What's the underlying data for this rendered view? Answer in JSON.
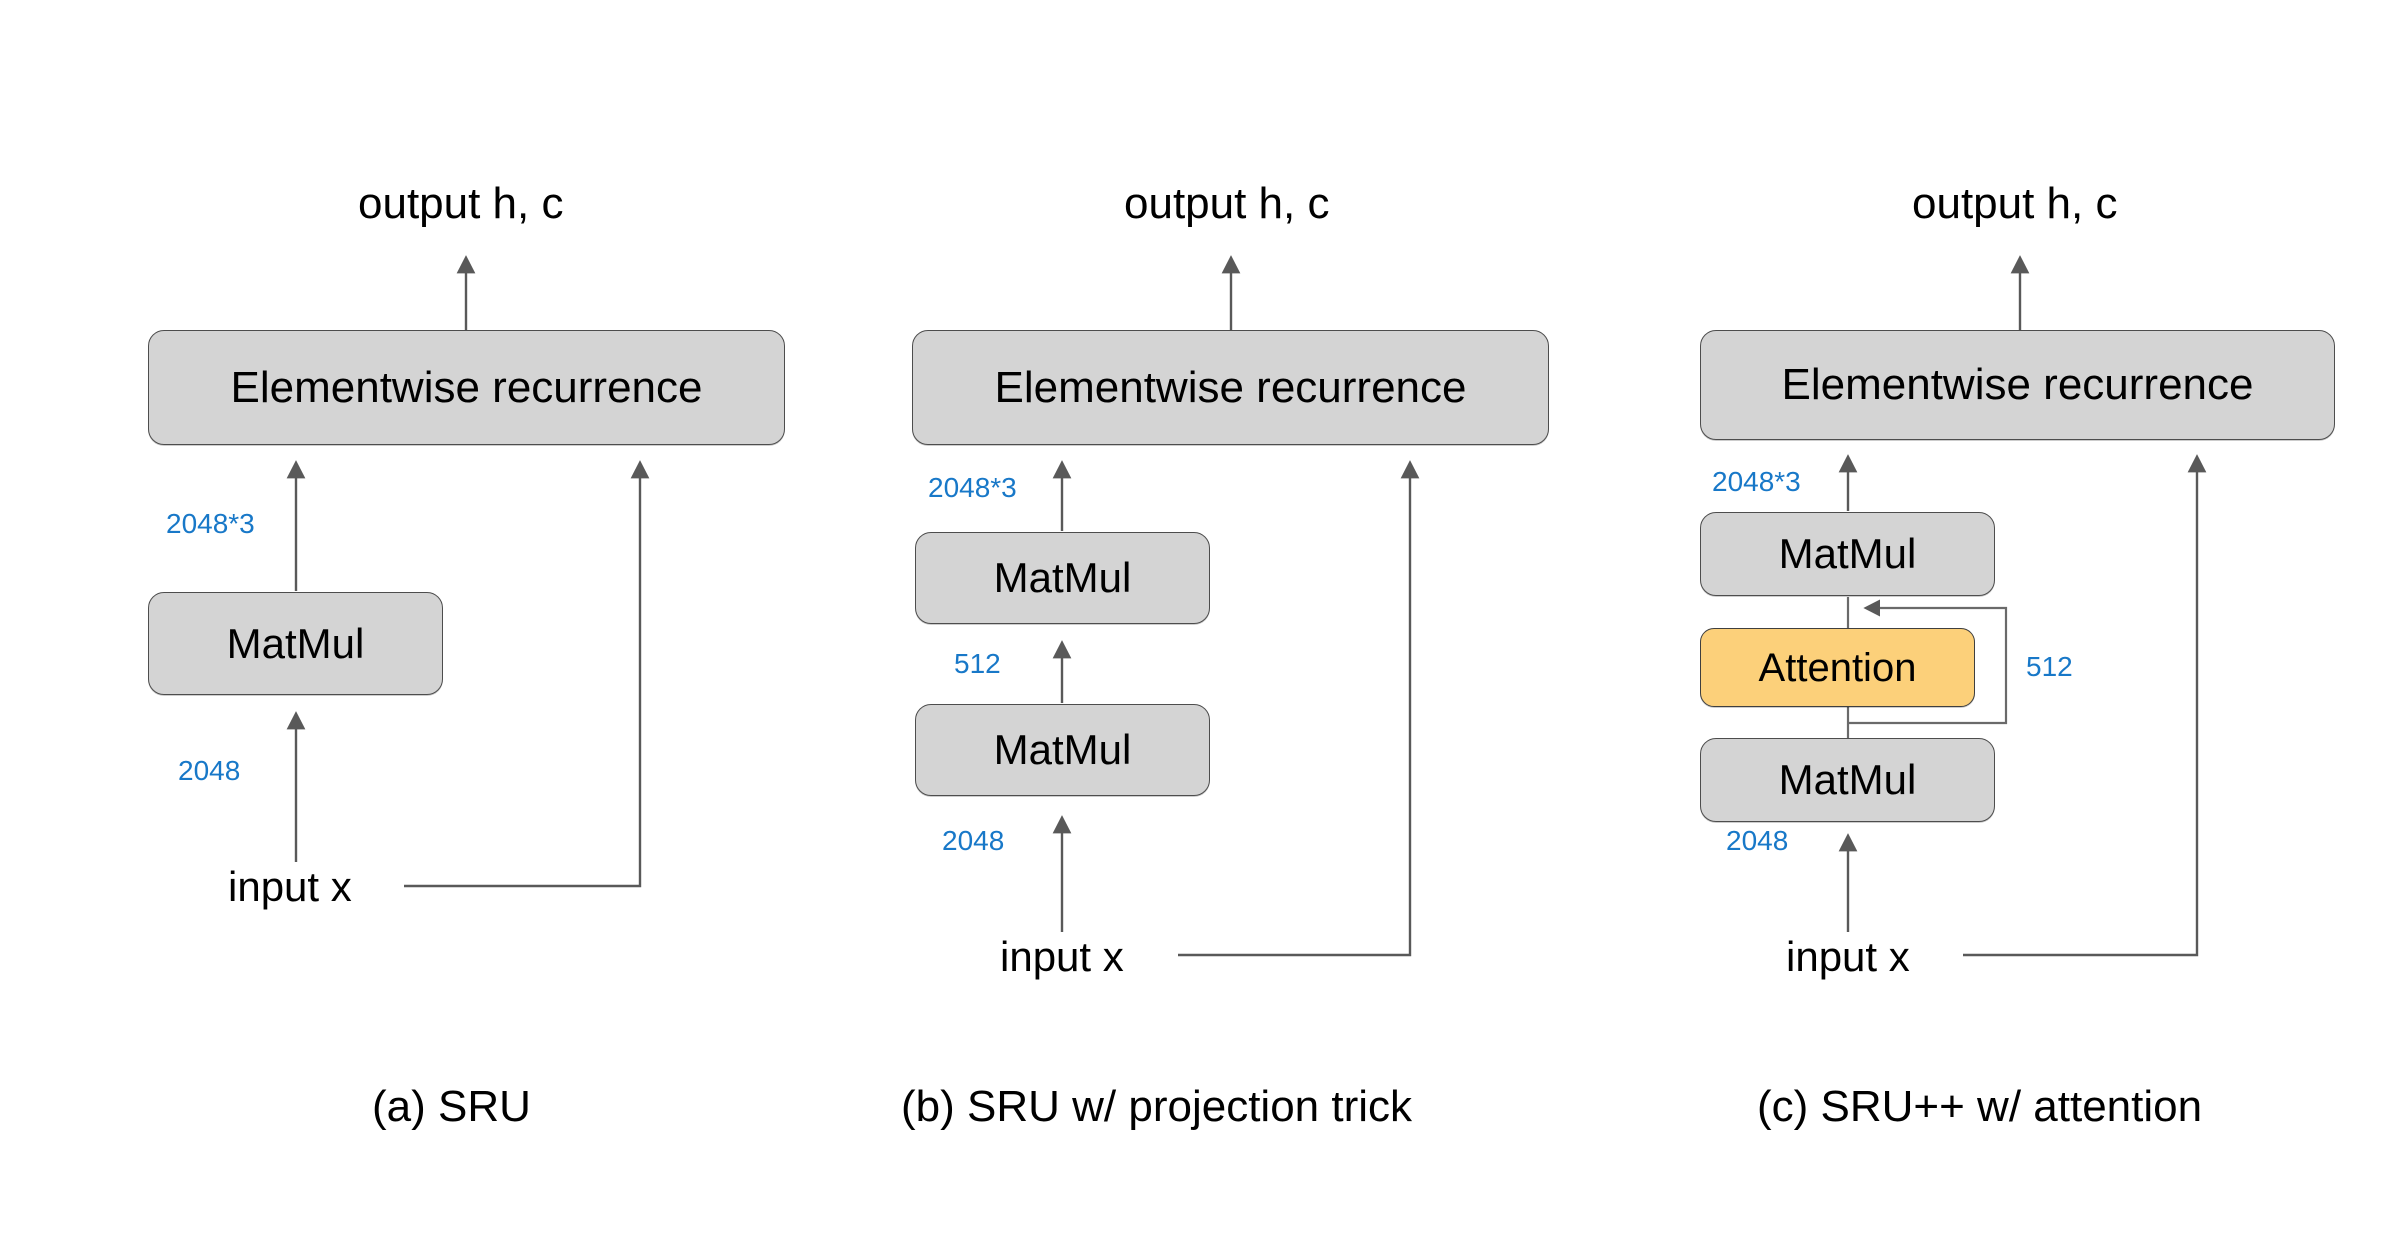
{
  "figure": {
    "common": {
      "output_label": "output h, c",
      "input_label": "input x",
      "elementwise_label": "Elementwise recurrence",
      "matmul_label": "MatMul",
      "attention_label": "Attention",
      "dim_2048": "2048",
      "dim_2048x3": "2048*3",
      "dim_512": "512",
      "accent_blue": "#1878c8",
      "node_gray": "#d4d4d4",
      "attention_orange": "#fcd07a",
      "wire_gray": "#595959"
    },
    "panels": [
      {
        "id": "a",
        "caption": "(a) SRU",
        "output": "output h, c",
        "input": "input x",
        "blocks": [
          {
            "name": "elementwise",
            "label": "Elementwise recurrence"
          },
          {
            "name": "matmul",
            "label": "MatMul"
          }
        ],
        "edge_labels": [
          "2048*3",
          "2048"
        ]
      },
      {
        "id": "b",
        "caption": "(b) SRU w/ projection trick",
        "output": "output h, c",
        "input": "input x",
        "blocks": [
          {
            "name": "elementwise",
            "label": "Elementwise recurrence"
          },
          {
            "name": "matmul-upper",
            "label": "MatMul"
          },
          {
            "name": "matmul-lower",
            "label": "MatMul"
          }
        ],
        "edge_labels": [
          "2048*3",
          "512",
          "2048"
        ]
      },
      {
        "id": "c",
        "caption": "(c) SRU++ w/ attention",
        "output": "output h, c",
        "input": "input x",
        "blocks": [
          {
            "name": "elementwise",
            "label": "Elementwise recurrence"
          },
          {
            "name": "matmul-upper",
            "label": "MatMul"
          },
          {
            "name": "attention",
            "label": "Attention"
          },
          {
            "name": "matmul-lower",
            "label": "MatMul"
          }
        ],
        "edge_labels": [
          "2048*3",
          "512",
          "2048"
        ]
      }
    ]
  },
  "chart_data": {
    "type": "diagram",
    "title": "SRU, SRU with projection trick, and SRU++ with attention architectures",
    "panels": [
      {
        "caption": "(a) SRU",
        "nodes": [
          "input x",
          "MatMul",
          "Elementwise recurrence",
          "output h, c"
        ],
        "edges": [
          {
            "from": "input x",
            "to": "MatMul",
            "label": "2048"
          },
          {
            "from": "MatMul",
            "to": "Elementwise recurrence",
            "label": "2048*3"
          },
          {
            "from": "input x",
            "to": "Elementwise recurrence",
            "label": ""
          },
          {
            "from": "Elementwise recurrence",
            "to": "output h, c",
            "label": ""
          }
        ]
      },
      {
        "caption": "(b) SRU w/ projection trick",
        "nodes": [
          "input x",
          "MatMul",
          "MatMul",
          "Elementwise recurrence",
          "output h, c"
        ],
        "edges": [
          {
            "from": "input x",
            "to": "MatMul (lower)",
            "label": "2048"
          },
          {
            "from": "MatMul (lower)",
            "to": "MatMul (upper)",
            "label": "512"
          },
          {
            "from": "MatMul (upper)",
            "to": "Elementwise recurrence",
            "label": "2048*3"
          },
          {
            "from": "input x",
            "to": "Elementwise recurrence",
            "label": ""
          },
          {
            "from": "Elementwise recurrence",
            "to": "output h, c",
            "label": ""
          }
        ]
      },
      {
        "caption": "(c) SRU++ w/ attention",
        "nodes": [
          "input x",
          "MatMul",
          "Attention",
          "MatMul",
          "Elementwise recurrence",
          "output h, c"
        ],
        "edges": [
          {
            "from": "input x",
            "to": "MatMul (lower)",
            "label": "2048"
          },
          {
            "from": "MatMul (lower)",
            "to": "Attention",
            "label": ""
          },
          {
            "from": "Attention",
            "to": "MatMul (upper)",
            "label": ""
          },
          {
            "from": "MatMul (lower)",
            "to": "MatMul (upper)",
            "label": "512",
            "note": "residual skip around Attention"
          },
          {
            "from": "MatMul (upper)",
            "to": "Elementwise recurrence",
            "label": "2048*3"
          },
          {
            "from": "input x",
            "to": "Elementwise recurrence",
            "label": ""
          },
          {
            "from": "Elementwise recurrence",
            "to": "output h, c",
            "label": ""
          }
        ]
      }
    ]
  }
}
